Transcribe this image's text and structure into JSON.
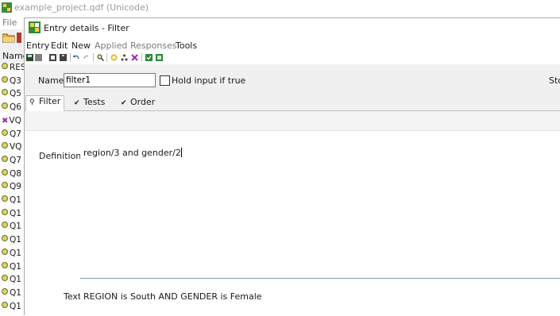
{
  "background_app": {
    "title": "example_project.qdf (Unicode)",
    "menu_file": "File",
    "list_header": "Name",
    "items": [
      {
        "label": "RESP",
        "icon": "dot"
      },
      {
        "label": "Q3",
        "icon": "dot"
      },
      {
        "label": "Q5",
        "icon": "dot"
      },
      {
        "label": "Q6",
        "icon": "dot"
      },
      {
        "label": "VQ",
        "icon": "x"
      },
      {
        "label": "Q7",
        "icon": "dot"
      },
      {
        "label": "VQ",
        "icon": "dot"
      },
      {
        "label": "Q7",
        "icon": "dot"
      },
      {
        "label": "Q8",
        "icon": "dot"
      },
      {
        "label": "Q9",
        "icon": "dot"
      },
      {
        "label": "Q1",
        "icon": "dot"
      },
      {
        "label": "Q1",
        "icon": "dot"
      },
      {
        "label": "Q1",
        "icon": "dot"
      },
      {
        "label": "Q1",
        "icon": "dot"
      },
      {
        "label": "Q1",
        "icon": "dot"
      },
      {
        "label": "Q1",
        "icon": "dot"
      },
      {
        "label": "Q1",
        "icon": "dot"
      },
      {
        "label": "Q1",
        "icon": "dot"
      },
      {
        "label": "Q1",
        "icon": "dot"
      }
    ]
  },
  "dialog": {
    "title": "Entry details - Filter",
    "menu": [
      "Entry",
      "Edit",
      "New",
      "Applied",
      "Responses",
      "Tools"
    ],
    "name_label": "Name",
    "name_value": "filter1",
    "hold_input_label": "Hold input if true",
    "hold_input_checked": false,
    "stop_label": "Stop",
    "tabs": [
      {
        "label": "Filter",
        "active": true
      },
      {
        "label": "Tests",
        "active": false
      },
      {
        "label": "Order",
        "active": false
      }
    ],
    "definition_label": "Definition",
    "definition_value": "region/3 and gender/2",
    "text_label": "Text",
    "text_value": "REGION is South AND GENDER is Female"
  },
  "colors": {
    "menu_dim": "#7a7a7a",
    "panel_border": "#c0c0c0",
    "divider": "#7f9db9"
  }
}
